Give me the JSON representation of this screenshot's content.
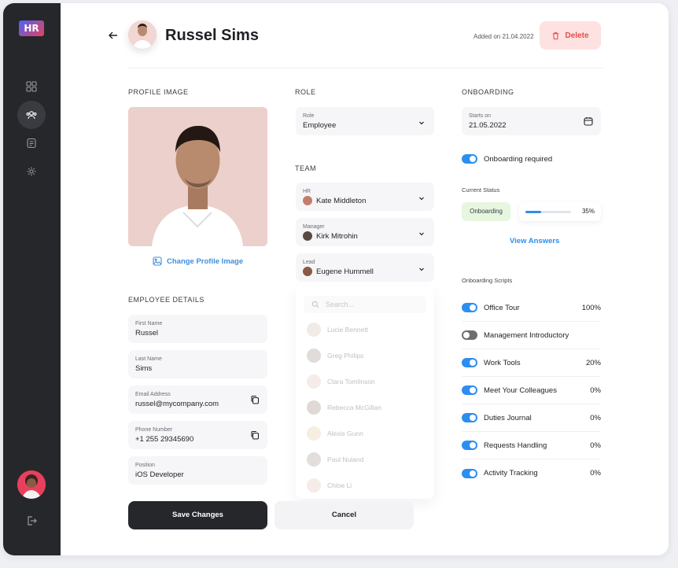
{
  "app": {
    "logo": "HR"
  },
  "sidebar": {
    "items": [
      {
        "name": "dashboard",
        "icon": "grid-icon"
      },
      {
        "name": "people",
        "icon": "users-icon"
      },
      {
        "name": "documents",
        "icon": "document-icon"
      },
      {
        "name": "settings",
        "icon": "gear-icon"
      }
    ],
    "active": "people"
  },
  "header": {
    "name": "Russel Sims",
    "added": "Added on 21.04.2022",
    "delete_label": "Delete"
  },
  "profile": {
    "title": "PROFILE IMAGE",
    "change_label": "Change Profile Image"
  },
  "details": {
    "title": "EMPLOYEE DETAILS",
    "first_name": {
      "label": "First Name",
      "value": "Russel"
    },
    "last_name": {
      "label": "Last Name",
      "value": "Sims"
    },
    "email": {
      "label": "Email Address",
      "value": "russel@mycompany.com"
    },
    "phone": {
      "label": "Phone Number",
      "value": "+1 255 29345690"
    },
    "position": {
      "label": "Position",
      "value": "iOS Developer"
    }
  },
  "role": {
    "title": "ROLE",
    "field": {
      "label": "Role",
      "value": "Employee"
    }
  },
  "team": {
    "title": "TEAM",
    "hr": {
      "label": "HR",
      "value": "Kate Middleton"
    },
    "manager": {
      "label": "Manager",
      "value": "Kirk Mitrohin"
    },
    "lead": {
      "label": "Lead",
      "value": "Eugene Hummell"
    },
    "search_placeholder": "Search...",
    "options": [
      "Lucie Bennett",
      "Greg Philips",
      "Clara Tomlinson",
      "Rebecca McGillan",
      "Alexis Gunn",
      "Paul Nuland",
      "Chloe Li"
    ]
  },
  "onboarding": {
    "title": "ONBOARDING",
    "starts": {
      "label": "Starts on",
      "value": "21.05.2022"
    },
    "required_label": "Onboarding required",
    "required": true,
    "current_status_label": "Current Status",
    "status": "Onboarding",
    "progress": 35,
    "progress_text": "35%",
    "view_answers": "View Answers",
    "scripts_title": "Onboarding Scripts",
    "scripts": [
      {
        "label": "Office Tour",
        "on": true,
        "pct": "100%"
      },
      {
        "label": "Management Introductory",
        "on": false,
        "pct": ""
      },
      {
        "label": "Work Tools",
        "on": true,
        "pct": "20%"
      },
      {
        "label": "Meet Your Colleagues",
        "on": true,
        "pct": "0%"
      },
      {
        "label": "Duties Journal",
        "on": true,
        "pct": "0%"
      },
      {
        "label": "Requests Handling",
        "on": true,
        "pct": "0%"
      },
      {
        "label": "Activity Tracking",
        "on": true,
        "pct": "0%"
      }
    ]
  },
  "actions": {
    "save": "Save Changes",
    "cancel": "Cancel"
  },
  "colors": {
    "accent": "#2c8ef0",
    "danger": "#e14d4d",
    "sidebar": "#26272b"
  }
}
